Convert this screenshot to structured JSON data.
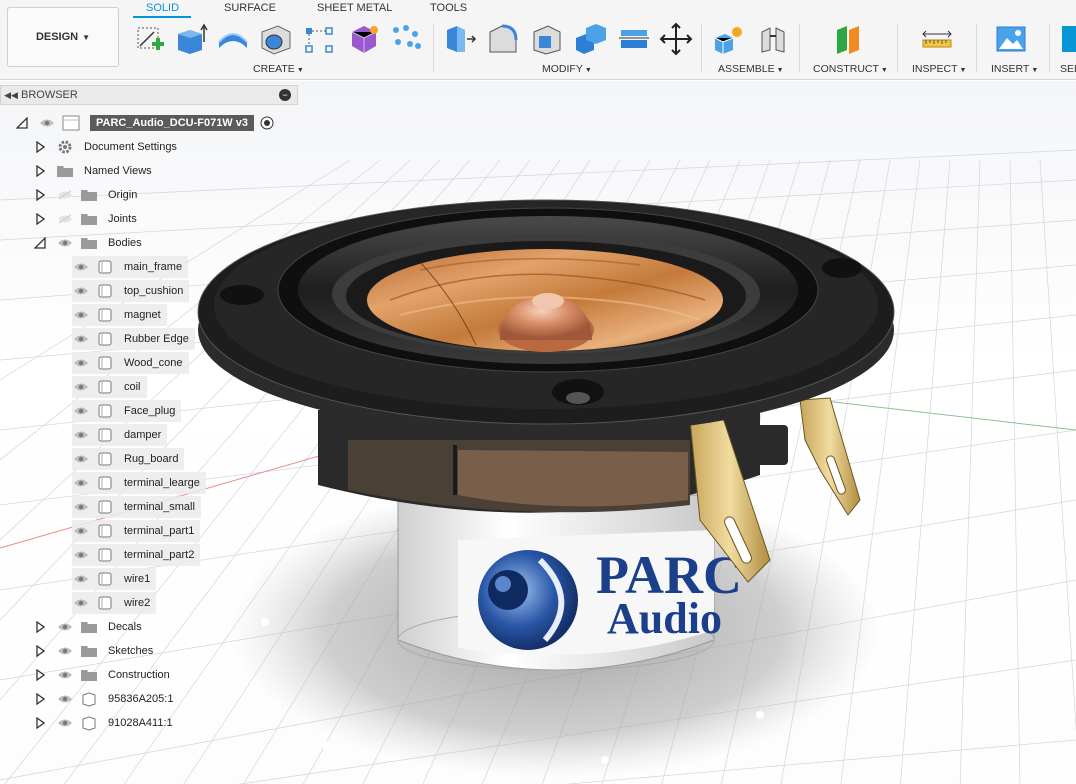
{
  "toolbar": {
    "design_label": "DESIGN",
    "tabs": [
      {
        "label": "SOLID",
        "active": true
      },
      {
        "label": "SURFACE",
        "active": false
      },
      {
        "label": "SHEET METAL",
        "active": false
      },
      {
        "label": "TOOLS",
        "active": false
      }
    ],
    "groups": {
      "create": "CREATE",
      "modify": "MODIFY",
      "assemble": "ASSEMBLE",
      "construct": "CONSTRUCT",
      "inspect": "INSPECT",
      "insert": "INSERT",
      "select": "SEL"
    }
  },
  "browser": {
    "title": "BROWSER",
    "root": "PARC_Audio_DCU-F071W v3",
    "items": [
      {
        "label": "Document Settings",
        "icon": "gear-icon"
      },
      {
        "label": "Named Views",
        "icon": "folder-icon"
      },
      {
        "label": "Origin",
        "icon": "folder-icon",
        "hidden": true
      },
      {
        "label": "Joints",
        "icon": "folder-icon",
        "hidden": true
      },
      {
        "label": "Bodies",
        "icon": "folder-icon",
        "expanded": true
      }
    ],
    "bodies": [
      "main_frame",
      "top_cushion",
      "magnet",
      "Rubber Edge",
      "Wood_cone",
      "coil",
      "Face_plug",
      "damper",
      "Rug_board",
      "terminal_learge",
      "terminal_small",
      "terminal_part1",
      "terminal_part2",
      "wire1",
      "wire2"
    ],
    "after": [
      {
        "label": "Decals",
        "icon": "folder-icon"
      },
      {
        "label": "Sketches",
        "icon": "folder-icon"
      },
      {
        "label": "Construction",
        "icon": "folder-icon"
      },
      {
        "label": "95836A205:1",
        "icon": "component-icon"
      },
      {
        "label": "91028A411:1",
        "icon": "component-icon"
      }
    ]
  },
  "model": {
    "decal_line1": "PARC",
    "decal_line2": "Audio"
  },
  "colors": {
    "accent": "#0696d7",
    "root_bg": "#5b5b5b"
  }
}
